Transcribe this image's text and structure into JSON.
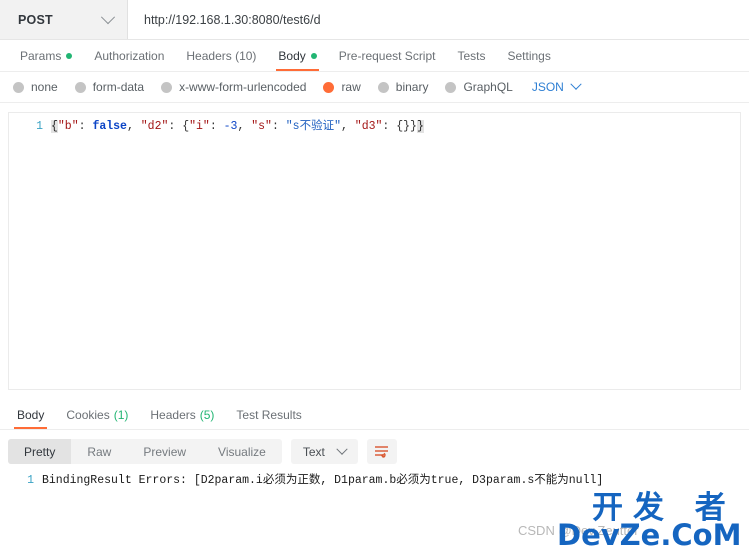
{
  "request": {
    "method": "POST",
    "url": "http://192.168.1.30:8080/test6/d",
    "tabs": [
      {
        "label": "Params",
        "dot": true,
        "active": false
      },
      {
        "label": "Authorization",
        "dot": false,
        "active": false
      },
      {
        "label": "Headers (10)",
        "dot": false,
        "active": false
      },
      {
        "label": "Body",
        "dot": true,
        "active": true
      },
      {
        "label": "Pre-request Script",
        "dot": false,
        "active": false
      },
      {
        "label": "Tests",
        "dot": false,
        "active": false
      },
      {
        "label": "Settings",
        "dot": false,
        "active": false
      }
    ],
    "body_types": [
      {
        "label": "none",
        "selected": false
      },
      {
        "label": "form-data",
        "selected": false
      },
      {
        "label": "x-www-form-urlencoded",
        "selected": false
      },
      {
        "label": "raw",
        "selected": true
      },
      {
        "label": "binary",
        "selected": false
      },
      {
        "label": "GraphQL",
        "selected": false
      }
    ],
    "raw_format": "JSON",
    "editor": {
      "line_number": "1",
      "raw_text": "{\"b\": false, \"d2\": {\"i\": -3, \"s\": \"s不验证\", \"d3\": {}}}",
      "tokens": [
        {
          "t": "{",
          "c": "tok-brace"
        },
        {
          "t": "\"b\"",
          "c": "tok-key"
        },
        {
          "t": ": ",
          "c": "tok-punc"
        },
        {
          "t": "false",
          "c": "tok-bool"
        },
        {
          "t": ", ",
          "c": "tok-punc"
        },
        {
          "t": "\"d2\"",
          "c": "tok-key"
        },
        {
          "t": ": ",
          "c": "tok-punc"
        },
        {
          "t": "{",
          "c": "tok-inner"
        },
        {
          "t": "\"i\"",
          "c": "tok-key"
        },
        {
          "t": ": ",
          "c": "tok-punc"
        },
        {
          "t": "-3",
          "c": "tok-num"
        },
        {
          "t": ", ",
          "c": "tok-punc"
        },
        {
          "t": "\"s\"",
          "c": "tok-key"
        },
        {
          "t": ": ",
          "c": "tok-punc"
        },
        {
          "t": "\"s不验证\"",
          "c": "tok-str"
        },
        {
          "t": ", ",
          "c": "tok-punc"
        },
        {
          "t": "\"d3\"",
          "c": "tok-key"
        },
        {
          "t": ": ",
          "c": "tok-punc"
        },
        {
          "t": "{}",
          "c": "tok-inner"
        },
        {
          "t": "}",
          "c": "tok-inner"
        },
        {
          "t": "}",
          "c": "tok-brace"
        }
      ]
    }
  },
  "response": {
    "tabs": [
      {
        "label": "Body",
        "count": "",
        "active": true
      },
      {
        "label": "Cookies",
        "count": "(1)",
        "active": false
      },
      {
        "label": "Headers",
        "count": "(5)",
        "active": false
      },
      {
        "label": "Test Results",
        "count": "",
        "active": false
      }
    ],
    "view_modes": [
      {
        "label": "Pretty",
        "active": true
      },
      {
        "label": "Raw",
        "active": false
      },
      {
        "label": "Preview",
        "active": false
      },
      {
        "label": "Visualize",
        "active": false
      }
    ],
    "format": "Text",
    "wrap_icon": "wrap-lines-icon",
    "line_number": "1",
    "body_text": "BindingResult Errors: [D2param.i必须为正数, D1param.b必须为true, D3param.s不能为null]"
  },
  "watermarks": {
    "cn": "开发 者",
    "en": "DevZe.CoM",
    "csdn": "CSDN @Dev.Zeutter"
  },
  "colors": {
    "accent": "#ff6c37",
    "green": "#22b573",
    "blue_link": "#2e7fd3",
    "gutter": "#3aa2c4",
    "watermark": "#1565c0"
  }
}
